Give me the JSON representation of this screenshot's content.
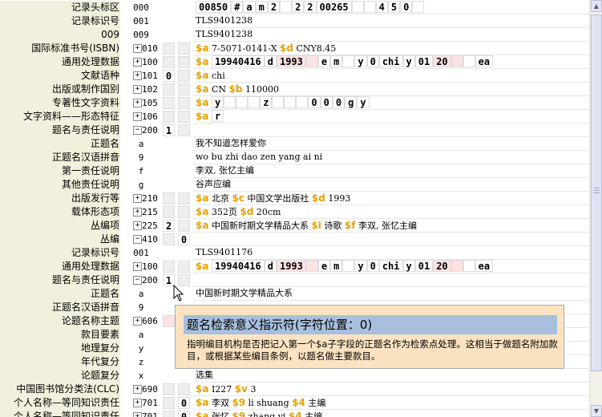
{
  "tooltip": {
    "title": "题名检索意义指示符(字符位置：0)",
    "body": "指明编目机构是否把记入第一个$a子字段的正题名作为检索点处理。这相当于做题名附加款目，或根据某些编目条例，以题名做主要款目。"
  },
  "colors": {
    "label_bg": "#f0f0dc",
    "subfield": "#e8a000",
    "indicator_bg": "#eeeeee",
    "highlight": "#fde2e2",
    "tooltip_bg": "#fbe3c2",
    "tooltip_title_bg": "#a8c0de"
  },
  "rows": [
    {
      "label": "记录头标区",
      "tag": "000",
      "tag_align": "c",
      "expander": "",
      "ind1": "",
      "ind2": "",
      "ind_style": "none",
      "segments": [
        {
          "t": "box",
          "v": "00850"
        },
        {
          "t": "box",
          "v": "#",
          "p": false
        },
        {
          "t": "box",
          "v": "a"
        },
        {
          "t": "box",
          "v": "m"
        },
        {
          "t": "box",
          "v": "2"
        },
        {
          "t": "box",
          "v": ""
        },
        {
          "t": "box",
          "v": "2"
        },
        {
          "t": "box",
          "v": "2"
        },
        {
          "t": "box",
          "v": "00265"
        },
        {
          "t": "box",
          "v": ""
        },
        {
          "t": "box",
          "v": ""
        },
        {
          "t": "box",
          "v": "4"
        },
        {
          "t": "box",
          "v": "5"
        },
        {
          "t": "box",
          "v": "0"
        },
        {
          "t": "box",
          "v": ""
        }
      ]
    },
    {
      "label": "记录标识号",
      "tag": "001",
      "tag_align": "c",
      "expander": "",
      "ind1": "",
      "ind2": "",
      "ind_style": "none",
      "segments": [
        {
          "t": "text",
          "v": "TLS9401238"
        }
      ]
    },
    {
      "label": "009",
      "tag": "009",
      "tag_align": "c",
      "expander": "",
      "ind1": "",
      "ind2": "",
      "ind_style": "none",
      "segments": [
        {
          "t": "text",
          "v": "TLS9401238"
        }
      ]
    },
    {
      "label": "国际标准书号(ISBN)",
      "tag": "010",
      "tag_align": "r",
      "expander": "+",
      "ind1": "",
      "ind2": "",
      "ind_style": "gray",
      "segments": [
        {
          "t": "sf",
          "v": "$a"
        },
        {
          "t": "text",
          "v": " 7-5071-0141-X "
        },
        {
          "t": "sf",
          "v": "$d"
        },
        {
          "t": "text",
          "v": " CNY8.45"
        }
      ]
    },
    {
      "label": "通用处理数据",
      "tag": "100",
      "tag_align": "r",
      "expander": "+",
      "ind1": "",
      "ind2": "",
      "ind_style": "gray",
      "segments": [
        {
          "t": "sf",
          "v": "$a"
        },
        {
          "t": "text",
          "v": " "
        },
        {
          "t": "box",
          "v": "19940416"
        },
        {
          "t": "box",
          "v": "d"
        },
        {
          "t": "box",
          "v": "1993",
          "p": true
        },
        {
          "t": "box",
          "v": "",
          "p": true
        },
        {
          "t": "box",
          "v": "e"
        },
        {
          "t": "box",
          "v": "m"
        },
        {
          "t": "box",
          "v": ""
        },
        {
          "t": "box",
          "v": "y"
        },
        {
          "t": "box",
          "v": "0"
        },
        {
          "t": "box",
          "v": "chi"
        },
        {
          "t": "box",
          "v": "y"
        },
        {
          "t": "box",
          "v": "01"
        },
        {
          "t": "box",
          "v": "20",
          "p": true
        },
        {
          "t": "box",
          "v": "",
          "p": true
        },
        {
          "t": "box",
          "v": ""
        },
        {
          "t": "box",
          "v": "ea"
        }
      ]
    },
    {
      "label": "文献语种",
      "tag": "101",
      "tag_align": "r",
      "expander": "+",
      "ind1": "0",
      "ind2": "",
      "ind_style": "white",
      "segments": [
        {
          "t": "sf",
          "v": "$a"
        },
        {
          "t": "text",
          "v": " chi"
        }
      ]
    },
    {
      "label": "出版或制作国别",
      "tag": "102",
      "tag_align": "r",
      "expander": "+",
      "ind1": "",
      "ind2": "",
      "ind_style": "gray",
      "segments": [
        {
          "t": "sf",
          "v": "$a"
        },
        {
          "t": "text",
          "v": " CN "
        },
        {
          "t": "sf",
          "v": "$b"
        },
        {
          "t": "text",
          "v": " 110000"
        }
      ]
    },
    {
      "label": "专著性文字资料",
      "tag": "105",
      "tag_align": "r",
      "expander": "+",
      "ind1": "",
      "ind2": "",
      "ind_style": "gray",
      "segments": [
        {
          "t": "sf",
          "v": "$a"
        },
        {
          "t": "text",
          "v": " "
        },
        {
          "t": "box",
          "v": "y"
        },
        {
          "t": "box",
          "v": ""
        },
        {
          "t": "box",
          "v": ""
        },
        {
          "t": "box",
          "v": ""
        },
        {
          "t": "box",
          "v": "z"
        },
        {
          "t": "box",
          "v": ""
        },
        {
          "t": "box",
          "v": ""
        },
        {
          "t": "box",
          "v": ""
        },
        {
          "t": "box",
          "v": "0"
        },
        {
          "t": "box",
          "v": "0"
        },
        {
          "t": "box",
          "v": "0"
        },
        {
          "t": "box",
          "v": "g"
        },
        {
          "t": "box",
          "v": "y"
        }
      ]
    },
    {
      "label": "文字资料——形态特征",
      "tag": "106",
      "tag_align": "r",
      "expander": "+",
      "ind1": "",
      "ind2": "",
      "ind_style": "gray",
      "segments": [
        {
          "t": "sf",
          "v": "$a"
        },
        {
          "t": "text",
          "v": " "
        },
        {
          "t": "box",
          "v": "r"
        }
      ]
    },
    {
      "label": "题名与责任说明",
      "tag": "200",
      "tag_align": "r",
      "expander": "−",
      "ind1": "1",
      "ind2": "",
      "ind_style": "white",
      "segments": []
    },
    {
      "label": "正题名",
      "tag": "a",
      "tag_align": "c",
      "expander": "",
      "ind1": "",
      "ind2": "",
      "ind_style": "none",
      "segments": [
        {
          "t": "text",
          "v": "我不知道怎样爱你"
        }
      ]
    },
    {
      "label": "正题名汉语拼音",
      "tag": "9",
      "tag_align": "c",
      "expander": "",
      "ind1": "",
      "ind2": "",
      "ind_style": "none",
      "segments": [
        {
          "t": "text",
          "v": "wo bu zhi dao zen yang ai ni"
        }
      ]
    },
    {
      "label": "第一责任说明",
      "tag": "f",
      "tag_align": "c",
      "expander": "",
      "ind1": "",
      "ind2": "",
      "ind_style": "none",
      "segments": [
        {
          "t": "text",
          "v": "李双, 张忆主编"
        }
      ]
    },
    {
      "label": "其他责任说明",
      "tag": "g",
      "tag_align": "c",
      "expander": "",
      "ind1": "",
      "ind2": "",
      "ind_style": "none",
      "segments": [
        {
          "t": "text",
          "v": "谷声应编"
        }
      ]
    },
    {
      "label": "出版发行等",
      "tag": "210",
      "tag_align": "r",
      "expander": "+",
      "ind1": "",
      "ind2": "",
      "ind_style": "gray",
      "segments": [
        {
          "t": "sf",
          "v": "$a"
        },
        {
          "t": "text",
          "v": " 北京 "
        },
        {
          "t": "sf",
          "v": "$c"
        },
        {
          "t": "text",
          "v": " 中国文学出版社 "
        },
        {
          "t": "sf",
          "v": "$d"
        },
        {
          "t": "text",
          "v": " 1993"
        }
      ]
    },
    {
      "label": "载体形态项",
      "tag": "215",
      "tag_align": "r",
      "expander": "+",
      "ind1": "",
      "ind2": "",
      "ind_style": "gray",
      "segments": [
        {
          "t": "sf",
          "v": "$a"
        },
        {
          "t": "text",
          "v": " 352页 "
        },
        {
          "t": "sf",
          "v": "$d"
        },
        {
          "t": "text",
          "v": " 20cm"
        }
      ]
    },
    {
      "label": "丛编项",
      "tag": "225",
      "tag_align": "r",
      "expander": "+",
      "ind1": "2",
      "ind2": "",
      "ind_style": "white",
      "segments": [
        {
          "t": "sf",
          "v": "$a"
        },
        {
          "t": "text",
          "v": " 中国新时期文学精品大系 "
        },
        {
          "t": "sf",
          "v": "$i"
        },
        {
          "t": "text",
          "v": " 诗歌 "
        },
        {
          "t": "sf",
          "v": "$f"
        },
        {
          "t": "text",
          "v": " 李双, 张忆主编"
        }
      ]
    },
    {
      "label": "丛编",
      "tag": "410",
      "tag_align": "r",
      "expander": "−",
      "ind1": "",
      "ind2": "0",
      "ind_style": "white",
      "segments": []
    },
    {
      "label": "记录标识号",
      "tag": "001",
      "tag_align": "c",
      "expander": "",
      "ind1": "",
      "ind2": "",
      "ind_style": "none",
      "segments": [
        {
          "t": "text",
          "v": "TLS9401176"
        }
      ]
    },
    {
      "label": "通用处理数据",
      "tag": "100",
      "tag_align": "r",
      "expander": "+",
      "ind1": "",
      "ind2": "",
      "ind_style": "gray",
      "segments": [
        {
          "t": "sf",
          "v": "$a"
        },
        {
          "t": "text",
          "v": " "
        },
        {
          "t": "box",
          "v": "19940416"
        },
        {
          "t": "box",
          "v": "d"
        },
        {
          "t": "box",
          "v": "1993",
          "p": true
        },
        {
          "t": "box",
          "v": "",
          "p": true
        },
        {
          "t": "box",
          "v": "e"
        },
        {
          "t": "box",
          "v": "m"
        },
        {
          "t": "box",
          "v": ""
        },
        {
          "t": "box",
          "v": "y"
        },
        {
          "t": "box",
          "v": "0"
        },
        {
          "t": "box",
          "v": "chi"
        },
        {
          "t": "box",
          "v": "y"
        },
        {
          "t": "box",
          "v": "01"
        },
        {
          "t": "box",
          "v": "20",
          "p": true
        },
        {
          "t": "box",
          "v": "",
          "p": true
        },
        {
          "t": "box",
          "v": ""
        },
        {
          "t": "box",
          "v": "ea"
        }
      ]
    },
    {
      "label": "题名与责任说明",
      "tag": "200",
      "tag_align": "r",
      "expander": "−",
      "ind1": "1",
      "ind2": "",
      "ind_style": "white",
      "segments": []
    },
    {
      "label": "正题名",
      "tag": "a",
      "tag_align": "c",
      "expander": "",
      "ind1": "",
      "ind2": "",
      "ind_style": "none",
      "segments": [
        {
          "t": "text",
          "v": "中国新时期文学精品大系"
        }
      ]
    },
    {
      "label": "正题名汉语拼音",
      "tag": "9",
      "tag_align": "c",
      "expander": "",
      "ind1": "",
      "ind2": "",
      "ind_style": "none",
      "segments": []
    },
    {
      "label": "论题名称主题",
      "tag": "606",
      "tag_align": "r",
      "expander": "+",
      "ind1": "",
      "ind2": "",
      "ind_style": "pink",
      "segments": []
    },
    {
      "label": "款目要素",
      "tag": "a",
      "tag_align": "c",
      "expander": "",
      "ind1": "",
      "ind2": "",
      "ind_style": "none",
      "segments": []
    },
    {
      "label": "地理复分",
      "tag": "y",
      "tag_align": "c",
      "expander": "",
      "ind1": "",
      "ind2": "",
      "ind_style": "none",
      "segments": []
    },
    {
      "label": "年代复分",
      "tag": "z",
      "tag_align": "c",
      "expander": "",
      "ind1": "",
      "ind2": "",
      "ind_style": "none",
      "segments": []
    },
    {
      "label": "论题复分",
      "tag": "x",
      "tag_align": "c",
      "expander": "",
      "ind1": "",
      "ind2": "",
      "ind_style": "none",
      "segments": [
        {
          "t": "text",
          "v": "选集"
        }
      ]
    },
    {
      "label": "中国图书馆分类法(CLC)",
      "tag": "690",
      "tag_align": "r",
      "expander": "+",
      "ind1": "",
      "ind2": "",
      "ind_style": "gray",
      "segments": [
        {
          "t": "sf",
          "v": "$a"
        },
        {
          "t": "text",
          "v": " I227 "
        },
        {
          "t": "sf",
          "v": "$v"
        },
        {
          "t": "text",
          "v": " 3"
        }
      ]
    },
    {
      "label": "个人名称—等同知识责任",
      "tag": "701",
      "tag_align": "r",
      "expander": "+",
      "ind1": "",
      "ind2": "0",
      "ind_style": "white",
      "segments": [
        {
          "t": "sf",
          "v": "$a"
        },
        {
          "t": "text",
          "v": " 李双 "
        },
        {
          "t": "sf",
          "v": "$9"
        },
        {
          "t": "text",
          "v": " li shuang "
        },
        {
          "t": "sf",
          "v": "$4"
        },
        {
          "t": "text",
          "v": " 主编"
        }
      ]
    },
    {
      "label": "个人名称—等同知识责任",
      "tag": "701",
      "tag_align": "r",
      "expander": "+",
      "ind1": "",
      "ind2": "0",
      "ind_style": "white",
      "segments": [
        {
          "t": "sf",
          "v": "$a"
        },
        {
          "t": "text",
          "v": " 张忆 "
        },
        {
          "t": "sf",
          "v": "$9"
        },
        {
          "t": "text",
          "v": " zhang yi "
        },
        {
          "t": "sf",
          "v": "$4"
        },
        {
          "t": "text",
          "v": " 主编"
        }
      ]
    }
  ]
}
